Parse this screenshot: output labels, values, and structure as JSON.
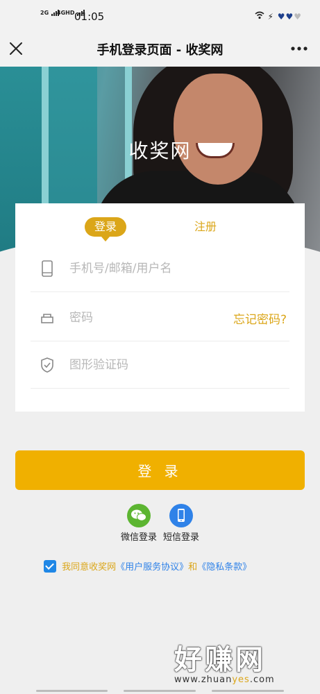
{
  "status_bar": {
    "signal_1": "2G",
    "signal_2": "4GHD",
    "time": "01:05"
  },
  "title_bar": {
    "title": "手机登录页面 - 收奖网",
    "close_icon": "close-icon",
    "more_icon": "more-icon"
  },
  "hero": {
    "site_name": "收奖网"
  },
  "tabs": {
    "login": "登录",
    "register": "注册"
  },
  "form": {
    "username_placeholder": "手机号/邮箱/用户名",
    "password_placeholder": "密码",
    "forgot_password": "忘记密码?",
    "captcha_placeholder": "图形验证码"
  },
  "login_button": "登 录",
  "alt_login": {
    "wechat": "微信登录",
    "sms": "短信登录"
  },
  "agreement": {
    "checked": true,
    "prefix": "我同意收奖网",
    "terms": "《用户服务协议》",
    "and": "和",
    "privacy": "《隐私条款》"
  },
  "watermark": {
    "text": "好赚网",
    "url_a": "www.zhuan",
    "url_b": "yes",
    "url_c": ".com"
  },
  "colors": {
    "accent": "#dba619",
    "button": "#f0b000",
    "link": "#2f82e8",
    "wechat": "#5cb531"
  }
}
